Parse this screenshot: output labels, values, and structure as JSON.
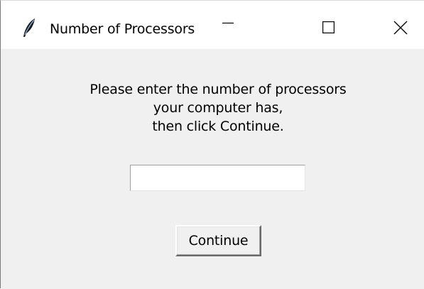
{
  "window": {
    "title": "Number of Processors",
    "app_icon": "feather-icon",
    "controls": {
      "minimize_icon": "minimize-icon",
      "maximize_icon": "maximize-icon",
      "close_icon": "close-icon"
    }
  },
  "dialog": {
    "message_lines": [
      "Please enter the number of processors",
      "your computer has,",
      "then click Continue."
    ],
    "input": {
      "value": "",
      "placeholder": ""
    },
    "continue_label": "Continue"
  },
  "colors": {
    "titlebar_bg": "#ffffff",
    "window_bg": "#f0f0f0",
    "input_bg": "#ffffff"
  }
}
